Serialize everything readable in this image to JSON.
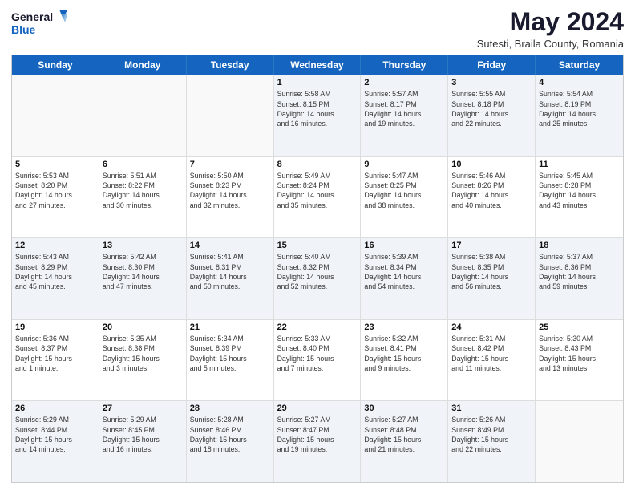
{
  "logo": {
    "line1": "General",
    "line2": "Blue"
  },
  "title": "May 2024",
  "location": "Sutesti, Braila County, Romania",
  "weekdays": [
    "Sunday",
    "Monday",
    "Tuesday",
    "Wednesday",
    "Thursday",
    "Friday",
    "Saturday"
  ],
  "rows": [
    [
      {
        "day": "",
        "info": ""
      },
      {
        "day": "",
        "info": ""
      },
      {
        "day": "",
        "info": ""
      },
      {
        "day": "1",
        "info": "Sunrise: 5:58 AM\nSunset: 8:15 PM\nDaylight: 14 hours\nand 16 minutes."
      },
      {
        "day": "2",
        "info": "Sunrise: 5:57 AM\nSunset: 8:17 PM\nDaylight: 14 hours\nand 19 minutes."
      },
      {
        "day": "3",
        "info": "Sunrise: 5:55 AM\nSunset: 8:18 PM\nDaylight: 14 hours\nand 22 minutes."
      },
      {
        "day": "4",
        "info": "Sunrise: 5:54 AM\nSunset: 8:19 PM\nDaylight: 14 hours\nand 25 minutes."
      }
    ],
    [
      {
        "day": "5",
        "info": "Sunrise: 5:53 AM\nSunset: 8:20 PM\nDaylight: 14 hours\nand 27 minutes."
      },
      {
        "day": "6",
        "info": "Sunrise: 5:51 AM\nSunset: 8:22 PM\nDaylight: 14 hours\nand 30 minutes."
      },
      {
        "day": "7",
        "info": "Sunrise: 5:50 AM\nSunset: 8:23 PM\nDaylight: 14 hours\nand 32 minutes."
      },
      {
        "day": "8",
        "info": "Sunrise: 5:49 AM\nSunset: 8:24 PM\nDaylight: 14 hours\nand 35 minutes."
      },
      {
        "day": "9",
        "info": "Sunrise: 5:47 AM\nSunset: 8:25 PM\nDaylight: 14 hours\nand 38 minutes."
      },
      {
        "day": "10",
        "info": "Sunrise: 5:46 AM\nSunset: 8:26 PM\nDaylight: 14 hours\nand 40 minutes."
      },
      {
        "day": "11",
        "info": "Sunrise: 5:45 AM\nSunset: 8:28 PM\nDaylight: 14 hours\nand 43 minutes."
      }
    ],
    [
      {
        "day": "12",
        "info": "Sunrise: 5:43 AM\nSunset: 8:29 PM\nDaylight: 14 hours\nand 45 minutes."
      },
      {
        "day": "13",
        "info": "Sunrise: 5:42 AM\nSunset: 8:30 PM\nDaylight: 14 hours\nand 47 minutes."
      },
      {
        "day": "14",
        "info": "Sunrise: 5:41 AM\nSunset: 8:31 PM\nDaylight: 14 hours\nand 50 minutes."
      },
      {
        "day": "15",
        "info": "Sunrise: 5:40 AM\nSunset: 8:32 PM\nDaylight: 14 hours\nand 52 minutes."
      },
      {
        "day": "16",
        "info": "Sunrise: 5:39 AM\nSunset: 8:34 PM\nDaylight: 14 hours\nand 54 minutes."
      },
      {
        "day": "17",
        "info": "Sunrise: 5:38 AM\nSunset: 8:35 PM\nDaylight: 14 hours\nand 56 minutes."
      },
      {
        "day": "18",
        "info": "Sunrise: 5:37 AM\nSunset: 8:36 PM\nDaylight: 14 hours\nand 59 minutes."
      }
    ],
    [
      {
        "day": "19",
        "info": "Sunrise: 5:36 AM\nSunset: 8:37 PM\nDaylight: 15 hours\nand 1 minute."
      },
      {
        "day": "20",
        "info": "Sunrise: 5:35 AM\nSunset: 8:38 PM\nDaylight: 15 hours\nand 3 minutes."
      },
      {
        "day": "21",
        "info": "Sunrise: 5:34 AM\nSunset: 8:39 PM\nDaylight: 15 hours\nand 5 minutes."
      },
      {
        "day": "22",
        "info": "Sunrise: 5:33 AM\nSunset: 8:40 PM\nDaylight: 15 hours\nand 7 minutes."
      },
      {
        "day": "23",
        "info": "Sunrise: 5:32 AM\nSunset: 8:41 PM\nDaylight: 15 hours\nand 9 minutes."
      },
      {
        "day": "24",
        "info": "Sunrise: 5:31 AM\nSunset: 8:42 PM\nDaylight: 15 hours\nand 11 minutes."
      },
      {
        "day": "25",
        "info": "Sunrise: 5:30 AM\nSunset: 8:43 PM\nDaylight: 15 hours\nand 13 minutes."
      }
    ],
    [
      {
        "day": "26",
        "info": "Sunrise: 5:29 AM\nSunset: 8:44 PM\nDaylight: 15 hours\nand 14 minutes."
      },
      {
        "day": "27",
        "info": "Sunrise: 5:29 AM\nSunset: 8:45 PM\nDaylight: 15 hours\nand 16 minutes."
      },
      {
        "day": "28",
        "info": "Sunrise: 5:28 AM\nSunset: 8:46 PM\nDaylight: 15 hours\nand 18 minutes."
      },
      {
        "day": "29",
        "info": "Sunrise: 5:27 AM\nSunset: 8:47 PM\nDaylight: 15 hours\nand 19 minutes."
      },
      {
        "day": "30",
        "info": "Sunrise: 5:27 AM\nSunset: 8:48 PM\nDaylight: 15 hours\nand 21 minutes."
      },
      {
        "day": "31",
        "info": "Sunrise: 5:26 AM\nSunset: 8:49 PM\nDaylight: 15 hours\nand 22 minutes."
      },
      {
        "day": "",
        "info": ""
      }
    ]
  ]
}
